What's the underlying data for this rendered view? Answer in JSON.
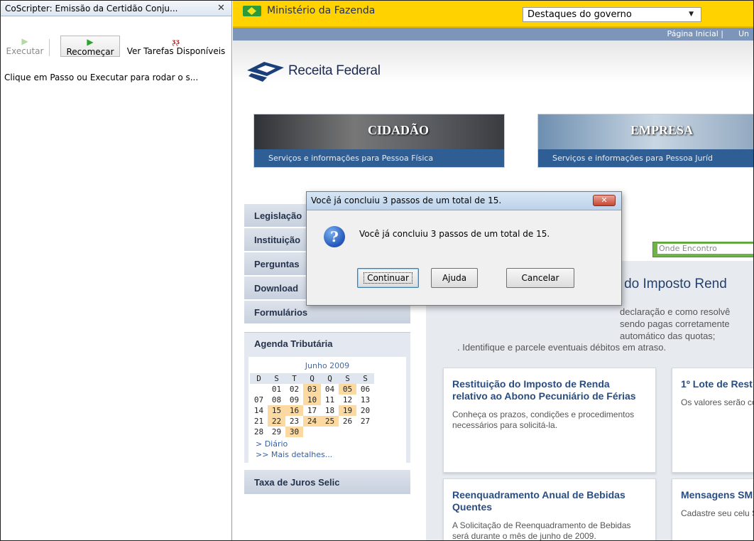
{
  "sidebar": {
    "title": "CoScripter: Emissão da Certidão Conju...",
    "close_glyph": "✕",
    "toolbar": {
      "execute_label": "Executar",
      "restart_label": "Recomeçar",
      "tasks_label": "Ver Tarefas Disponíveis"
    },
    "hint": "Clique em Passo ou Executar para rodar o s..."
  },
  "browser": {
    "gov_bar": {
      "title": "Ministério da Fazenda",
      "select_value": "Destaques do governo"
    },
    "topnav": {
      "links": "Página Inicial |",
      "links_cut": "Un"
    },
    "site_title": "Receita Federal",
    "banners": [
      {
        "title": "CIDADÃO",
        "subtitle": "Serviços e informações para Pessoa Física"
      },
      {
        "title": "EMPRESA",
        "subtitle": "Serviços e informações para Pessoa Juríd"
      }
    ],
    "left_nav": [
      "Legislação",
      "Instituição",
      "Perguntas",
      "Download",
      "Formulários"
    ],
    "agenda": {
      "title": "Agenda Tributária",
      "month": "Junho 2009",
      "weekdays": [
        "D",
        "S",
        "T",
        "Q",
        "Q",
        "S",
        "S"
      ],
      "weeks": [
        [
          "",
          "01",
          "02",
          "03",
          "04",
          "05",
          "06"
        ],
        [
          "07",
          "08",
          "09",
          "10",
          "11",
          "12",
          "13"
        ],
        [
          "14",
          "15",
          "16",
          "17",
          "18",
          "19",
          "20"
        ],
        [
          "21",
          "22",
          "23",
          "24",
          "25",
          "26",
          "27"
        ],
        [
          "28",
          "29",
          "30",
          "",
          "",
          "",
          ""
        ]
      ],
      "highlighted": [
        "03",
        "05",
        "10",
        "15",
        "16",
        "19",
        "22",
        "24",
        "25",
        "30"
      ],
      "link_daily": "> Diário",
      "link_more": ">> Mais detalhes..."
    },
    "selic_title": "Taxa de Juros Selic",
    "onde_encontro": "Onde Encontro",
    "irpf": {
      "heading": "io do Imposto Rend",
      "lines": [
        "declaração e como resolvê",
        "sendo pagas corretamente",
        "automático das quotas;",
        ". Identifique e parcele eventuais débitos em atraso."
      ]
    },
    "news": [
      {
        "title": "Restituição do Imposto de Renda relativo ao Abono Pecuniário de Férias",
        "text": "Conheça os prazos, condições e procedimentos necessários para solicitá-la."
      },
      {
        "title": "1º Lote de Rest",
        "text": "Os valores serão contas bancárias"
      },
      {
        "title": "Reenquadramento Anual de Bebidas Quentes",
        "text": "A Solicitação de Reenquadramento de Bebidas será durante o mês de junho de 2009."
      },
      {
        "title": "Mensagens SM Imposto de Ren",
        "text": "Cadastre seu celu SMS quando sua"
      }
    ]
  },
  "dialog": {
    "title": "Você já concluiu 3 passos de um total de 15.",
    "message": "Você já concluiu 3 passos de um total de 15.",
    "icon_glyph": "?",
    "buttons": {
      "continue": "Continuar",
      "help": "Ajuda",
      "cancel": "Cancelar"
    }
  }
}
